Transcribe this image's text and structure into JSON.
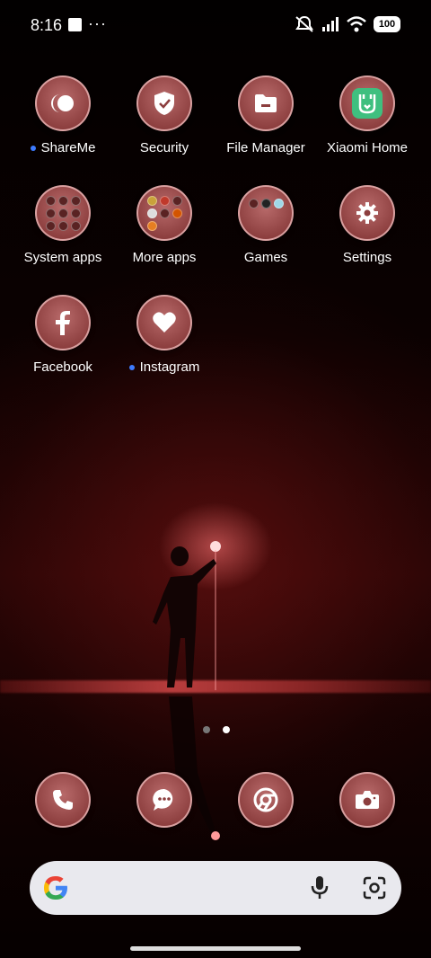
{
  "status_bar": {
    "time": "8:16",
    "more_dots": "···",
    "battery": "100",
    "icons": [
      "screenshot-indicator-icon",
      "mute-icon",
      "signal-icon",
      "wifi-icon",
      "battery-icon"
    ]
  },
  "apps": [
    {
      "label": "ShareMe",
      "icon": "shareme-icon",
      "new": true
    },
    {
      "label": "Security",
      "icon": "shield-icon",
      "new": false
    },
    {
      "label": "File Manager",
      "icon": "folder-icon",
      "new": false
    },
    {
      "label": "Xiaomi Home",
      "icon": "mi-home-icon",
      "new": false
    },
    {
      "label": "System apps",
      "icon": "folder-grid-icon",
      "new": false
    },
    {
      "label": "More apps",
      "icon": "folder-grid-icon",
      "new": false
    },
    {
      "label": "Games",
      "icon": "folder-grid-icon",
      "new": false
    },
    {
      "label": "Settings",
      "icon": "gear-icon",
      "new": false
    },
    {
      "label": "Facebook",
      "icon": "facebook-icon",
      "new": false
    },
    {
      "label": "Instagram",
      "icon": "heart-icon",
      "new": true
    }
  ],
  "pager": {
    "pages": 2,
    "active_page": 2
  },
  "dock": [
    {
      "icon": "phone-icon"
    },
    {
      "icon": "messages-icon"
    },
    {
      "icon": "chrome-icon"
    },
    {
      "icon": "camera-icon"
    }
  ],
  "search_bar": {
    "icons": [
      "google-g-icon",
      "microphone-icon",
      "google-lens-icon"
    ]
  },
  "colors": {
    "icon_fill": "#9a4a4a",
    "new_dot": "#3d7bff",
    "search_bg": "#e9e9ee"
  }
}
